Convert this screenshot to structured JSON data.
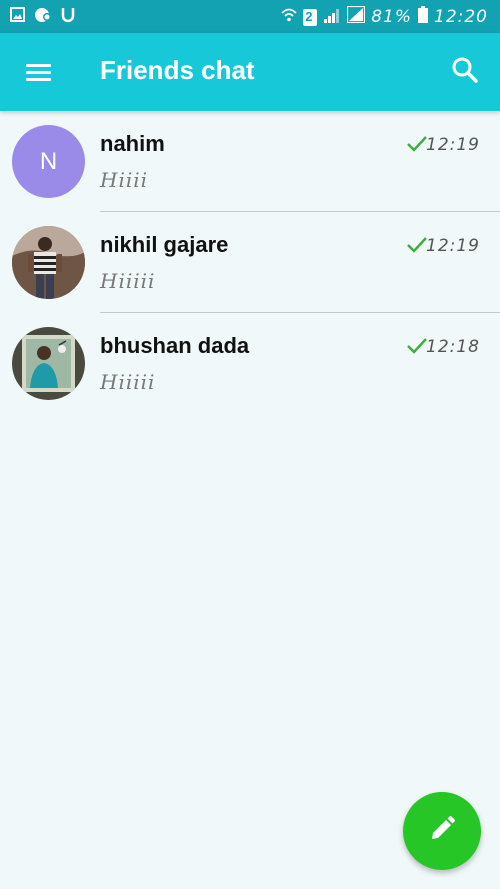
{
  "status_bar": {
    "battery_percent": "81%",
    "time": "12:20",
    "sim_slot": "2",
    "left_icons": [
      "image-icon",
      "chat-bubble-icon",
      "magnet-icon"
    ],
    "right_icons": [
      "wifi-icon",
      "sim-icon",
      "signal-icon",
      "signal-icon",
      "battery-icon"
    ]
  },
  "app_bar": {
    "title": "Friends chat",
    "menu_icon": "hamburger-menu-icon",
    "search_icon": "search-icon",
    "color": "#17c9d8"
  },
  "chats": [
    {
      "name": "nahim",
      "message": "Hiiii",
      "time": "12:19",
      "avatar_letter": "N",
      "avatar_color": "#9b8be8",
      "status_icon": "check-icon"
    },
    {
      "name": "nikhil gajare",
      "message": "Hiiiii",
      "time": "12:19",
      "avatar_type": "photo",
      "status_icon": "check-icon"
    },
    {
      "name": "bhushan dada",
      "message": "Hiiiii",
      "time": "12:18",
      "avatar_type": "photo",
      "status_icon": "check-icon"
    }
  ],
  "fab": {
    "icon": "pencil-icon",
    "color": "#27c627"
  }
}
